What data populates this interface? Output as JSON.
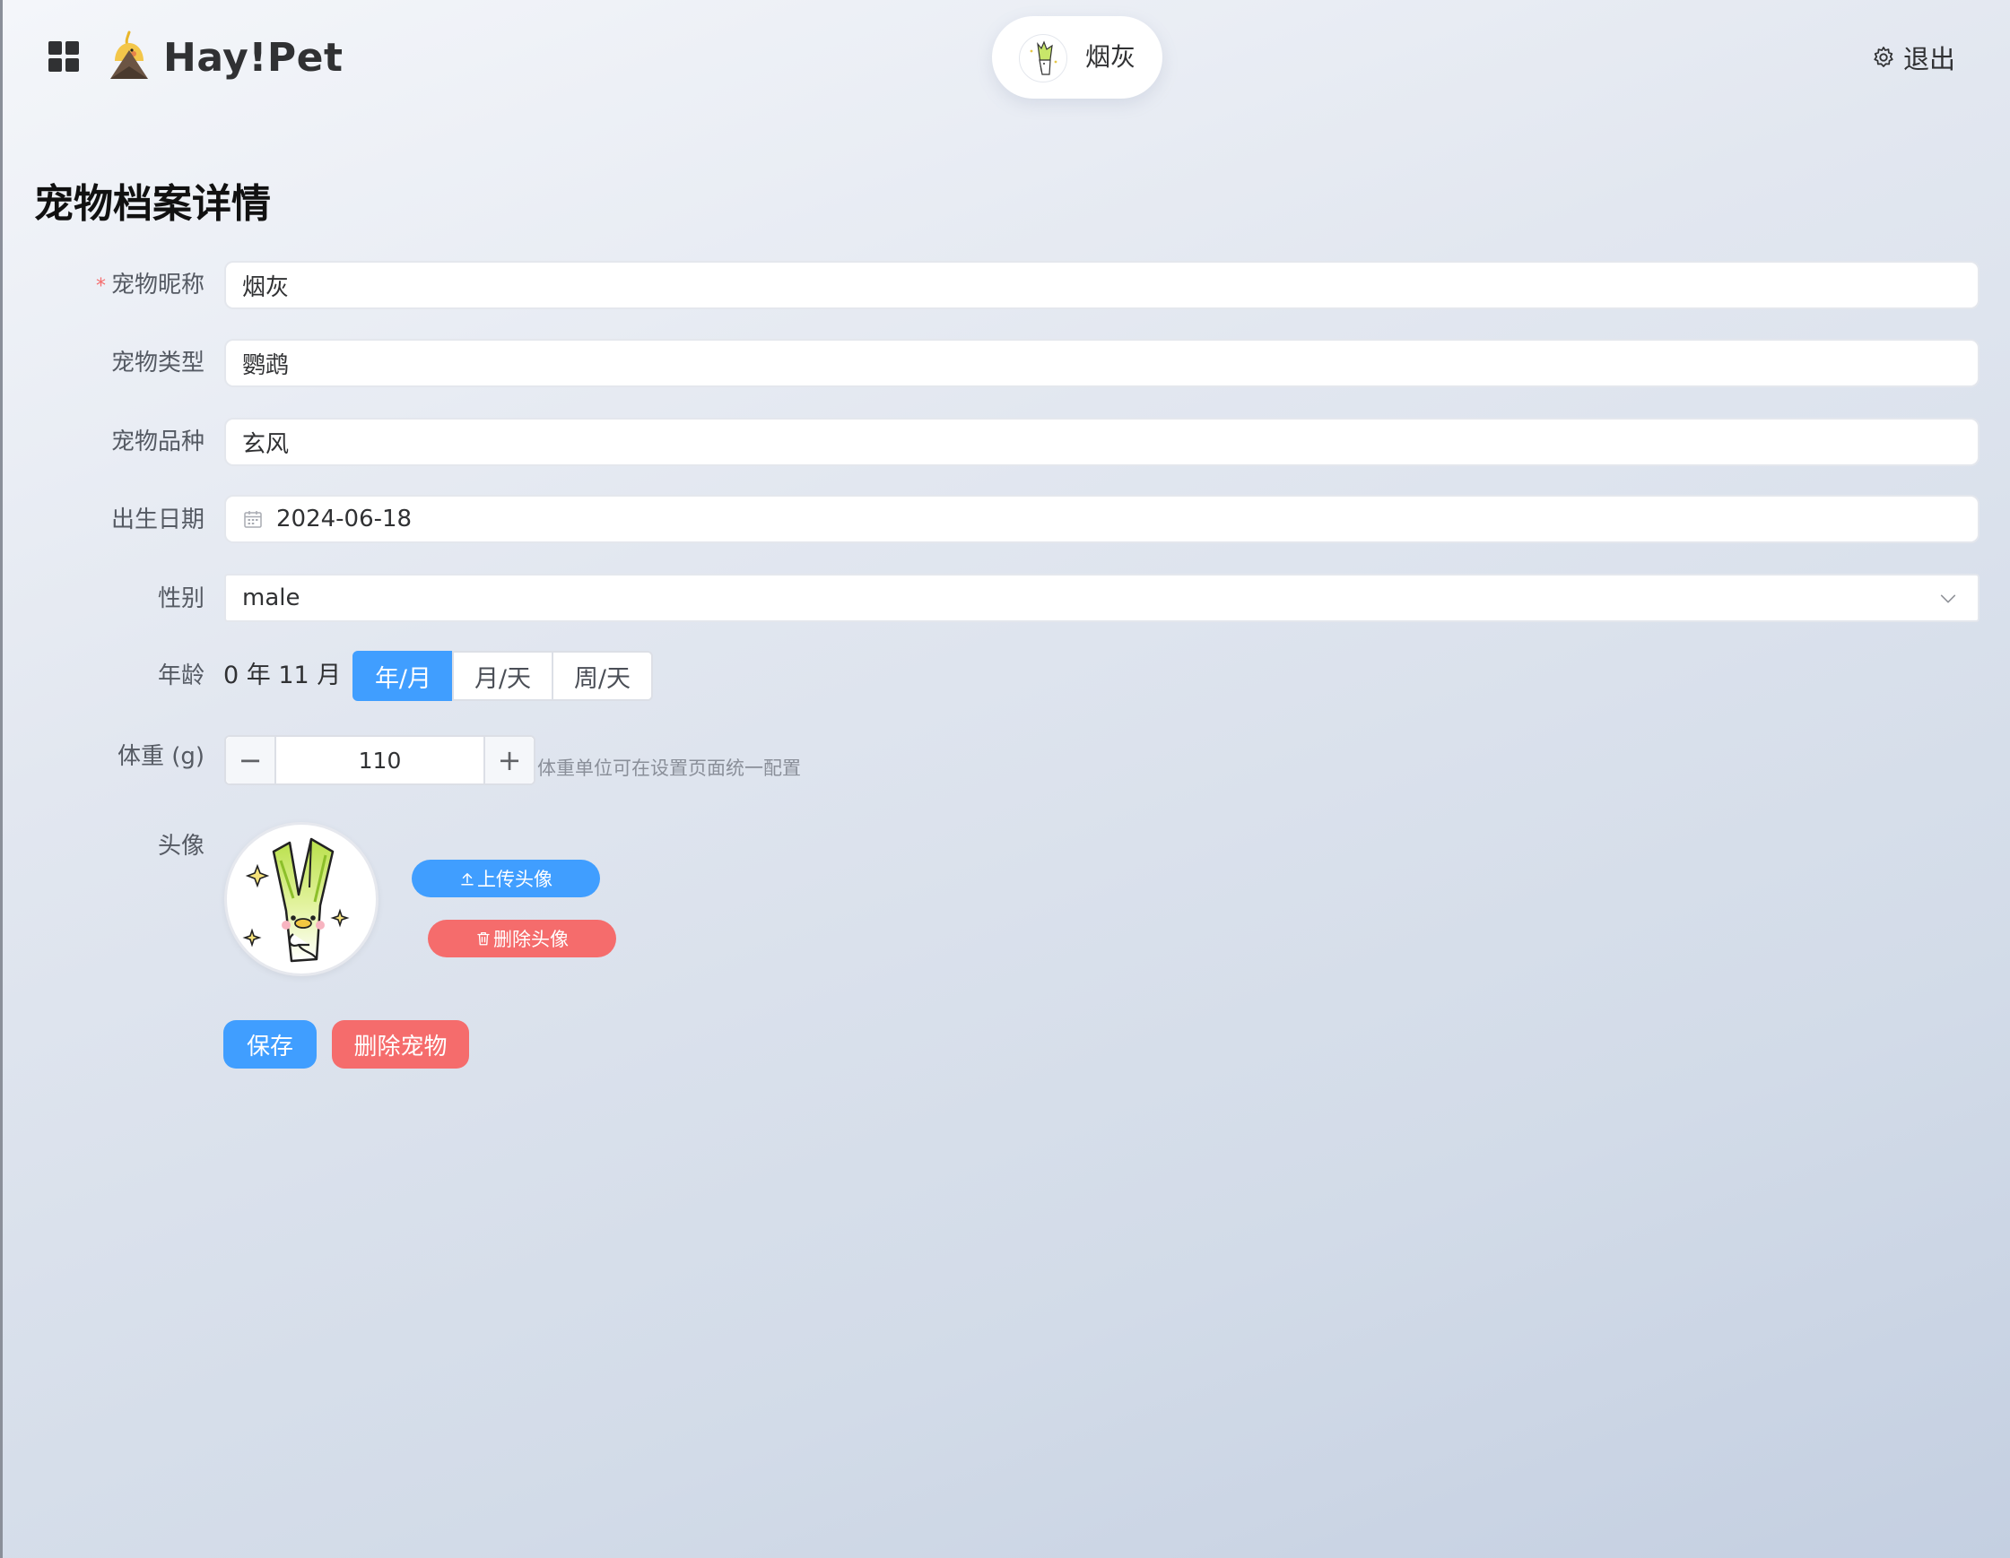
{
  "header": {
    "brand": "Hay!Pet",
    "current_pet": "烟灰",
    "logout_label": "退出"
  },
  "page": {
    "title": "宠物档案详情"
  },
  "form": {
    "nickname": {
      "label": "宠物昵称",
      "required_mark": "*",
      "value": "烟灰"
    },
    "type": {
      "label": "宠物类型",
      "value": "鹦鹉"
    },
    "breed": {
      "label": "宠物品种",
      "value": "玄风"
    },
    "birthday": {
      "label": "出生日期",
      "value": "2024-06-18"
    },
    "gender": {
      "label": "性别",
      "value": "male"
    },
    "age": {
      "label": "年龄",
      "value": "0 年 11 月",
      "modes": [
        "年/月",
        "月/天",
        "周/天"
      ],
      "selected_mode": "年/月"
    },
    "weight": {
      "label": "体重 (g)",
      "value": "110",
      "minus": "−",
      "plus": "+",
      "hint": "体重单位可在设置页面统一配置"
    },
    "avatar": {
      "label": "头像",
      "upload_label": "上传头像",
      "remove_label": "删除头像"
    }
  },
  "actions": {
    "save_label": "保存",
    "delete_label": "删除宠物"
  },
  "colors": {
    "primary": "#409eff",
    "danger": "#f56c6c",
    "required": "#f56c6c"
  },
  "icons": [
    "app-grid-icon",
    "cockatiel-logo-icon",
    "gear-icon",
    "calendar-icon",
    "chevron-down-icon",
    "upload-icon",
    "trash-icon"
  ]
}
